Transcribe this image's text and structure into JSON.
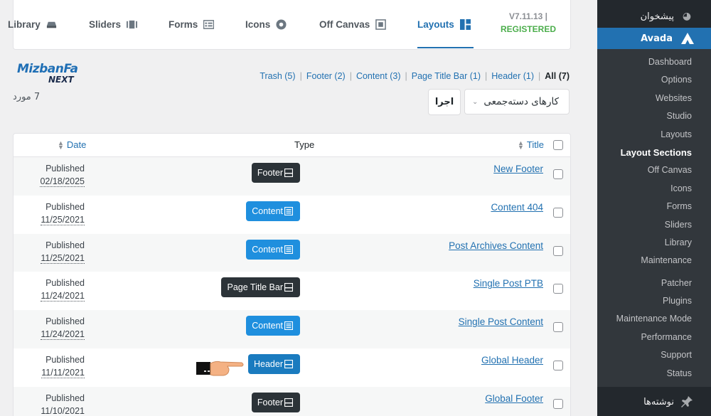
{
  "tabs": [
    {
      "label": "Library",
      "icon": "library-icon"
    },
    {
      "label": "Sliders",
      "icon": "sliders-icon"
    },
    {
      "label": "Forms",
      "icon": "forms-icon"
    },
    {
      "label": "Icons",
      "icon": "icons-icon"
    },
    {
      "label": "Off Canvas",
      "icon": "off-canvas-icon"
    },
    {
      "label": "Layouts",
      "icon": "layouts-icon",
      "active": true
    }
  ],
  "version": {
    "number": "V7.11.13",
    "separator": "|",
    "status": "REGISTERED"
  },
  "brand": {
    "line1": "MizbanFa",
    "line2": "NEXT"
  },
  "filters": {
    "trash": "Trash (5)",
    "footer": "Footer (2)",
    "content": "Content (3)",
    "page_title_bar": "Page Title Bar (1)",
    "header": "Header (1)",
    "all_label": "All",
    "all_count": "(7)",
    "separator": "|"
  },
  "item_count": "7 مورد",
  "bulk_actions": {
    "label": "کارهای دسته‌جمعی",
    "apply": "اجرا"
  },
  "table": {
    "headers": {
      "date": "Date",
      "type": "Type",
      "title": "Title"
    },
    "rows": [
      {
        "title": "New Footer",
        "type": "Footer",
        "style": "dark",
        "status": "Published",
        "date": "02/18/2025"
      },
      {
        "title": "Content 404",
        "type": "Content",
        "style": "blue",
        "status": "Published",
        "date": "11/25/2021"
      },
      {
        "title": "Post Archives Content",
        "type": "Content",
        "style": "blue",
        "status": "Published",
        "date": "11/25/2021"
      },
      {
        "title": "Single Post PTB",
        "type": "Page Title Bar",
        "style": "dark",
        "status": "Published",
        "date": "11/24/2021"
      },
      {
        "title": "Single Post Content",
        "type": "Content",
        "style": "blue",
        "status": "Published",
        "date": "11/24/2021"
      },
      {
        "title": "Global Header",
        "type": "Header",
        "style": "navy",
        "status": "Published",
        "date": "11/11/2021"
      },
      {
        "title": "Global Footer",
        "type": "Footer",
        "style": "dark",
        "status": "Published",
        "date": "11/10/2021"
      }
    ]
  },
  "sidebar": {
    "dashboard": "پیشخوان",
    "active": "Avada",
    "submenu": [
      "Dashboard",
      "Options",
      "Websites",
      "Studio",
      "Layouts",
      "Layout Sections",
      "Off Canvas",
      "Icons",
      "Forms",
      "Sliders",
      "Library",
      "Maintenance"
    ],
    "submenu2": [
      "Patcher",
      "Plugins",
      "Maintenance Mode",
      "Performance",
      "Support",
      "Status"
    ],
    "current": "Layout Sections",
    "posts": "نوشته‌ها"
  },
  "colors": {
    "accent": "#2271b1",
    "sidebar": "#23282d",
    "registered": "#4cae4c"
  }
}
